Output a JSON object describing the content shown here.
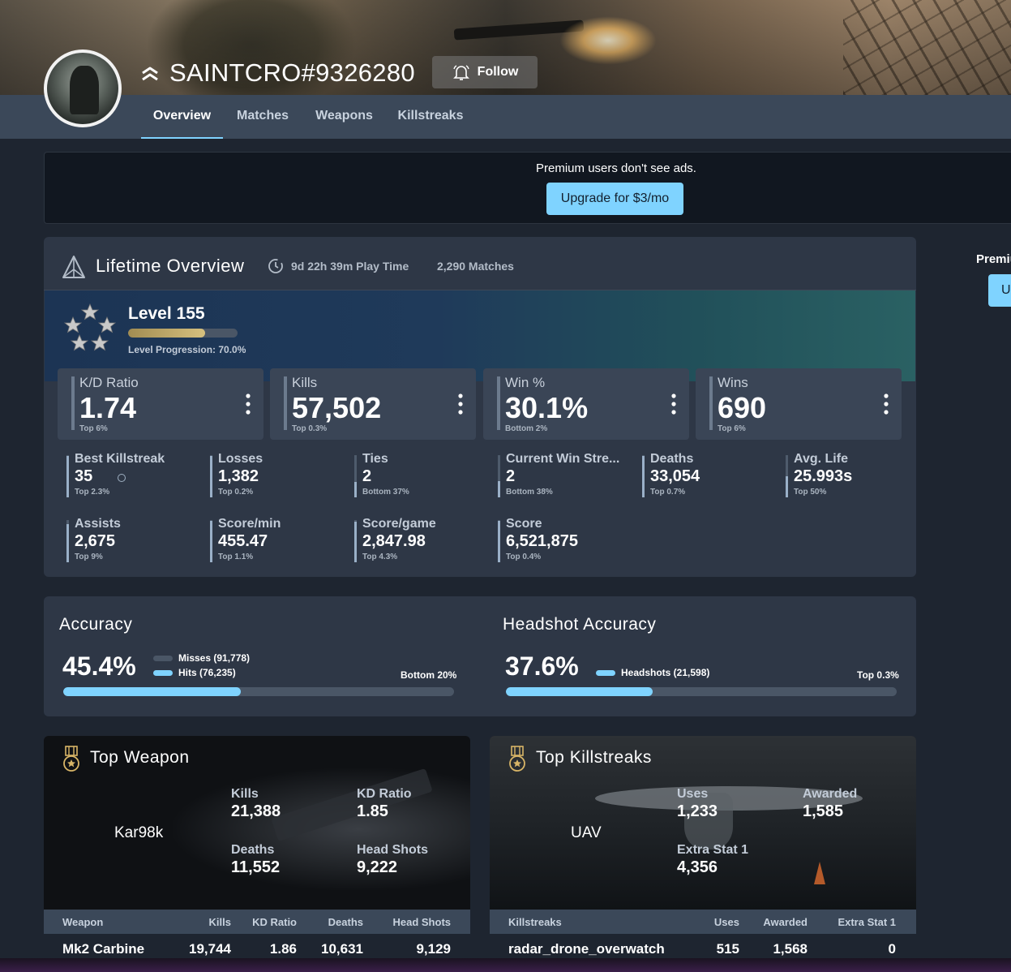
{
  "profile": {
    "username": "SAINTCRO#9326280",
    "follow_label": "Follow"
  },
  "tabs": [
    {
      "label": "Overview",
      "active": true
    },
    {
      "label": "Matches"
    },
    {
      "label": "Weapons"
    },
    {
      "label": "Killstreaks"
    }
  ],
  "premium": {
    "message": "Premium users don't see ads.",
    "upgrade_label": "Upgrade for $3/mo",
    "side_label": "Premiu",
    "side_button": "U"
  },
  "overview": {
    "title": "Lifetime Overview",
    "play_time": "9d 22h 39m Play Time",
    "matches": "2,290 Matches",
    "level": {
      "title": "Level 155",
      "progress_text": "Level Progression: 70.0%",
      "progress": 0.7
    },
    "big_stats": [
      {
        "label": "K/D Ratio",
        "value": "1.74",
        "rank": "Top 6%"
      },
      {
        "label": "Kills",
        "value": "57,502",
        "rank": "Top 0.3%"
      },
      {
        "label": "Win %",
        "value": "30.1%",
        "rank": "Bottom 2%"
      },
      {
        "label": "Wins",
        "value": "690",
        "rank": "Top 6%"
      }
    ],
    "stats": [
      {
        "label": "Best Killstreak",
        "value": "35",
        "rank": "Top 2.3%",
        "percentile": 0.98
      },
      {
        "label": "Losses",
        "value": "1,382",
        "rank": "Top 0.2%",
        "percentile": 0.99
      },
      {
        "label": "Ties",
        "value": "2",
        "rank": "Bottom 37%",
        "percentile": 0.37
      },
      {
        "label": "Current Win Stre...",
        "value": "2",
        "rank": "Bottom 38%",
        "percentile": 0.38
      },
      {
        "label": "Deaths",
        "value": "33,054",
        "rank": "Top 0.7%",
        "percentile": 0.99
      },
      {
        "label": "Avg. Life",
        "value": "25.993s",
        "rank": "Top 50%",
        "percentile": 0.5
      },
      {
        "label": "Assists",
        "value": "2,675",
        "rank": "Top 9%",
        "percentile": 0.91
      },
      {
        "label": "Score/min",
        "value": "455.47",
        "rank": "Top 1.1%",
        "percentile": 0.99
      },
      {
        "label": "Score/game",
        "value": "2,847.98",
        "rank": "Top 4.3%",
        "percentile": 0.96
      },
      {
        "label": "Score",
        "value": "6,521,875",
        "rank": "Top 0.4%",
        "percentile": 0.99
      }
    ]
  },
  "accuracy": {
    "title": "Accuracy",
    "value": "45.4%",
    "misses_label": "Misses (91,778)",
    "hits_label": "Hits (76,235)",
    "rank": "Bottom 20%",
    "fill": 0.454
  },
  "headshot": {
    "title": "Headshot Accuracy",
    "value": "37.6%",
    "headshots_label": "Headshots (21,598)",
    "rank": "Top 0.3%",
    "fill": 0.376
  },
  "top_weapon": {
    "title": "Top Weapon",
    "name": "Kar98k",
    "stats": [
      {
        "label": "Kills",
        "value": "21,388"
      },
      {
        "label": "KD Ratio",
        "value": "1.85"
      },
      {
        "label": "Deaths",
        "value": "11,552"
      },
      {
        "label": "Head Shots",
        "value": "9,222"
      }
    ],
    "table_headers": [
      "Weapon",
      "Kills",
      "KD Ratio",
      "Deaths",
      "Head Shots"
    ],
    "rows": [
      [
        "Mk2 Carbine",
        "19,744",
        "1.86",
        "10,631",
        "9,129"
      ]
    ]
  },
  "top_killstreaks": {
    "title": "Top Killstreaks",
    "name": "UAV",
    "stats": [
      {
        "label": "Uses",
        "value": "1,233"
      },
      {
        "label": "Awarded",
        "value": "1,585"
      },
      {
        "label": "Extra Stat 1",
        "value": "4,356"
      }
    ],
    "table_headers": [
      "Killstreaks",
      "Uses",
      "Awarded",
      "Extra Stat 1"
    ],
    "rows": [
      [
        "radar_drone_overwatch",
        "515",
        "1,568",
        "0"
      ]
    ]
  },
  "colors": {
    "accent": "#7fd3ff",
    "tabbar": "#3b4859",
    "card": "#2e3746",
    "background": "#1e2530"
  }
}
